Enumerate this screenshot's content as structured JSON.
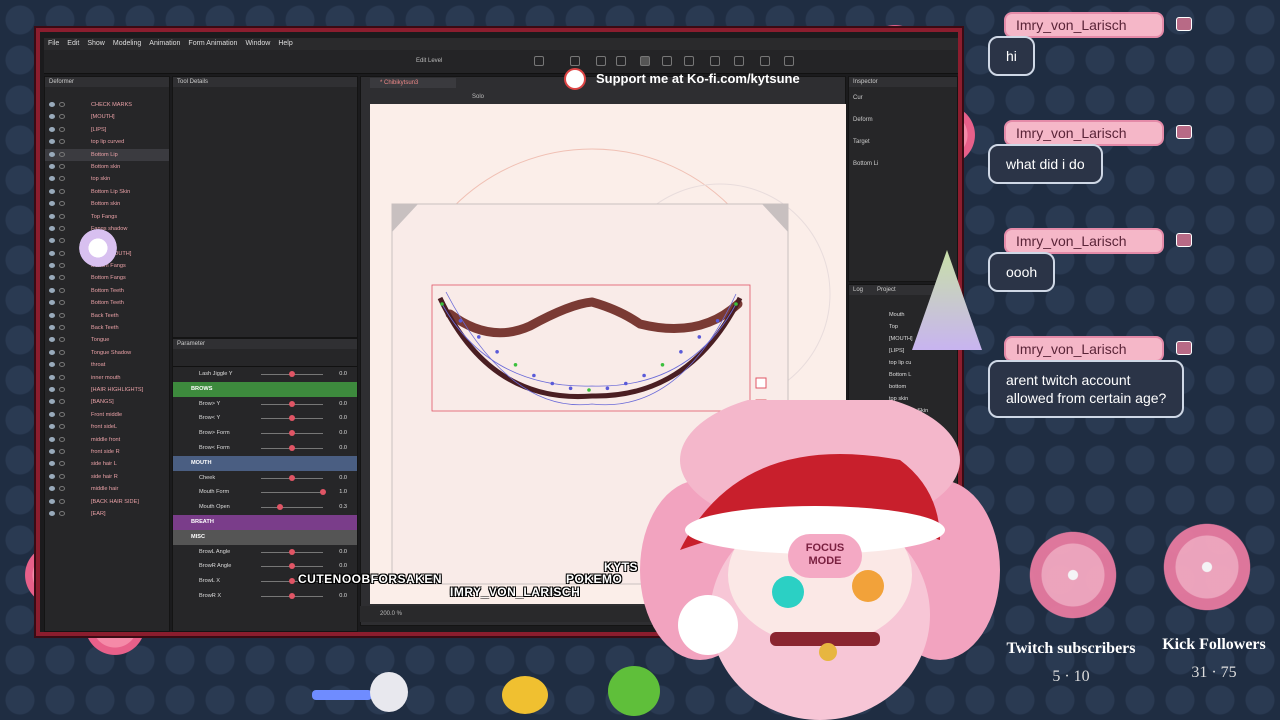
{
  "menu": [
    "File",
    "Edit",
    "Show",
    "Modeling",
    "Animation",
    "Form Animation",
    "Window",
    "Help"
  ],
  "toolbar": {
    "edit_level": "Edit Level",
    "levels": "1  2  3"
  },
  "deformer": {
    "title": "Deformer",
    "items": [
      {
        "label": "CHECK MARKS"
      },
      {
        "label": "[MOUTH]"
      },
      {
        "label": "[LIPS]"
      },
      {
        "label": "top lip curved"
      },
      {
        "label": "Bottom Lip",
        "selected": true
      },
      {
        "label": "Bottom skin"
      },
      {
        "label": "top skin"
      },
      {
        "label": "Bottom Lip Skin"
      },
      {
        "label": "Bottom skin"
      },
      {
        "label": "Top Fangs"
      },
      {
        "label": "Fangs shadow"
      },
      {
        "label": "Shadow"
      },
      {
        "label": "[BACK MOUTH]"
      },
      {
        "label": "Bottom Fangs"
      },
      {
        "label": "Bottom Fangs"
      },
      {
        "label": "Bottom Teeth"
      },
      {
        "label": "Bottom Teeth"
      },
      {
        "label": "Back Teeth"
      },
      {
        "label": "Back Teeth"
      },
      {
        "label": "Tongue"
      },
      {
        "label": "Tongue Shadow"
      },
      {
        "label": "throat"
      },
      {
        "label": "inner mouth"
      },
      {
        "label": "[HAIR HIGHLIGHTS]"
      },
      {
        "label": "[BANGS]"
      },
      {
        "label": "Front middle"
      },
      {
        "label": "front sideL"
      },
      {
        "label": "middle front"
      },
      {
        "label": "front side R"
      },
      {
        "label": "side hair L"
      },
      {
        "label": "side hair R"
      },
      {
        "label": "middle hair"
      },
      {
        "label": "[BACK HAIR SIDE]"
      },
      {
        "label": "[EAR]"
      }
    ]
  },
  "tooldetails": {
    "title": "Tool Details"
  },
  "parameter": {
    "title": "Parameter",
    "rows": [
      {
        "label": "Lash Jiggle Y",
        "value": "0.0",
        "knob": 0.5
      },
      {
        "label": "BROWS",
        "group": true,
        "color": "#3d8a3d"
      },
      {
        "label": "Brow> Y",
        "value": "0.0",
        "knob": 0.5
      },
      {
        "label": "Brow< Y",
        "value": "0.0",
        "knob": 0.5
      },
      {
        "label": "Brow> Form",
        "value": "0.0",
        "knob": 0.5
      },
      {
        "label": "Brow< Form",
        "value": "0.0",
        "knob": 0.5
      },
      {
        "label": "MOUTH",
        "group": true,
        "color": "#4a5e82"
      },
      {
        "label": "Cheek",
        "value": "0.0",
        "knob": 0.5
      },
      {
        "label": "Mouth Form",
        "value": "1.0",
        "knob": 1.0
      },
      {
        "label": "Mouth Open",
        "value": "0.3",
        "knob": 0.3
      },
      {
        "label": "BREATH",
        "group": true,
        "color": "#7a3d8a"
      },
      {
        "label": "MISC",
        "group": true,
        "color": "#555"
      },
      {
        "label": "BrowL Angle",
        "value": "0.0",
        "knob": 0.5
      },
      {
        "label": "BrowR Angle",
        "value": "0.0",
        "knob": 0.5
      },
      {
        "label": "BrowL X",
        "value": "0.0",
        "knob": 0.5
      },
      {
        "label": "BrowR X",
        "value": "0.0",
        "knob": 0.5
      }
    ]
  },
  "canvas": {
    "tab": "* Chibikytsun3",
    "solo": "Solo",
    "zoom": "200.0 %",
    "ruler": [
      "900",
      "800",
      "700",
      "600",
      "500",
      "400",
      "300",
      "200"
    ]
  },
  "inspector": {
    "title": "Inspector",
    "items": [
      "Cur",
      "Deform",
      "Target",
      "Bottom Li"
    ]
  },
  "log": {
    "tabs": [
      "Log",
      "Project"
    ],
    "items": [
      "Mouth",
      "Top",
      "[MOUTH]",
      "[LIPS]",
      "top lip cu",
      "Bottom L",
      "bottom",
      "top skin",
      "Bottom Lip Skin"
    ]
  },
  "overlay": {
    "support": "Support me at Ko-fi.com/kytsune",
    "focus": "FOCUS MODE"
  },
  "credits": [
    "CUTENOOBFORSAKEN",
    "IMRY_VON_LARISCH",
    "KYTS",
    "POKEMO"
  ],
  "chat": [
    {
      "user": "Imry_von_Larisch",
      "text": "hi"
    },
    {
      "user": "Imry_von_Larisch",
      "text": "what did i do"
    },
    {
      "user": "Imry_von_Larisch",
      "text": "oooh"
    },
    {
      "user": "Imry_von_Larisch",
      "text": "arent twitch account\nallowed from certain age?"
    }
  ],
  "stats": {
    "twitch": {
      "label": "Twitch subscribers",
      "value": "5 · 10"
    },
    "kick": {
      "label": "Kick Followers",
      "value": "31 · 75"
    }
  },
  "colors": {
    "frame": "#8b1d2e",
    "chat_name_bg": "#f5b7c8",
    "chat_msg_bg": "#2b3447",
    "lip": "#7a3a34"
  }
}
